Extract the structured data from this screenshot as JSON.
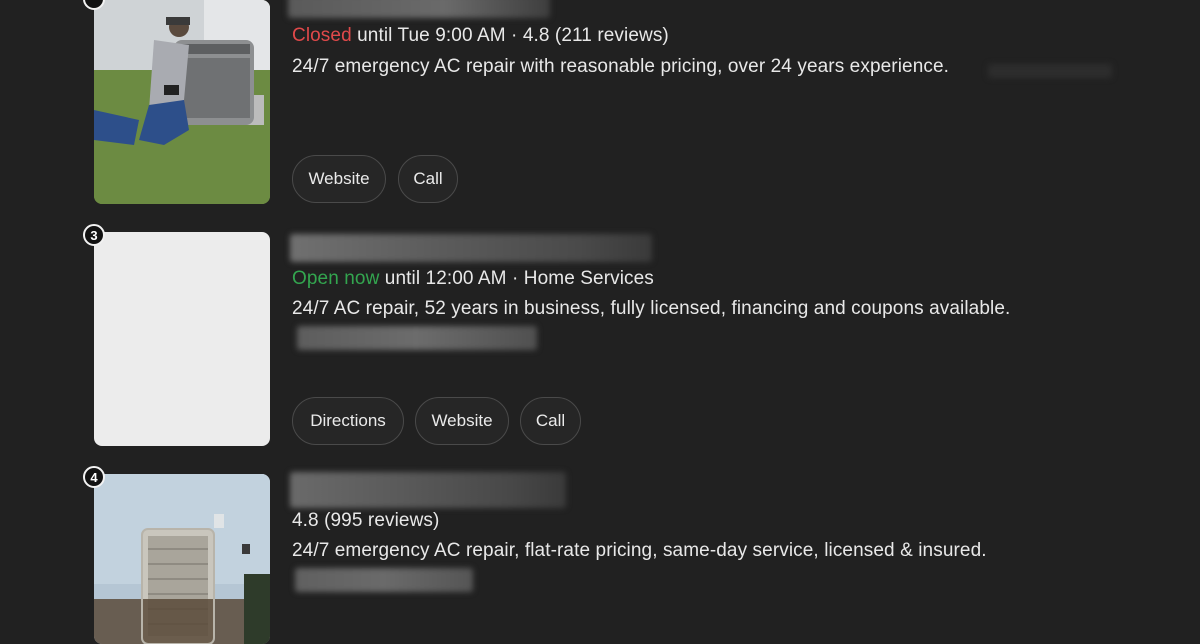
{
  "listings": [
    {
      "rank": "",
      "status": "Closed",
      "status_rest": " until Tue 9:00 AM · 4.8 (211 reviews)",
      "description": "24/7 emergency AC repair with reasonable pricing, over 24 years experience.",
      "buttons": [
        "Website",
        "Call"
      ]
    },
    {
      "rank": "3",
      "status": "Open now",
      "status_rest": " until 12:00 AM · Home Services",
      "description": "24/7 AC repair, 52 years in business, fully licensed, financing and coupons available.",
      "buttons": [
        "Directions",
        "Website",
        "Call"
      ]
    },
    {
      "rank": "4",
      "status": "",
      "status_rest": "4.8 (995 reviews)",
      "description": "24/7 emergency AC repair, flat-rate pricing, same-day service, licensed & insured.",
      "buttons": []
    }
  ],
  "colors": {
    "background": "#212121",
    "closed": "#e0494a",
    "open": "#33a54f"
  }
}
